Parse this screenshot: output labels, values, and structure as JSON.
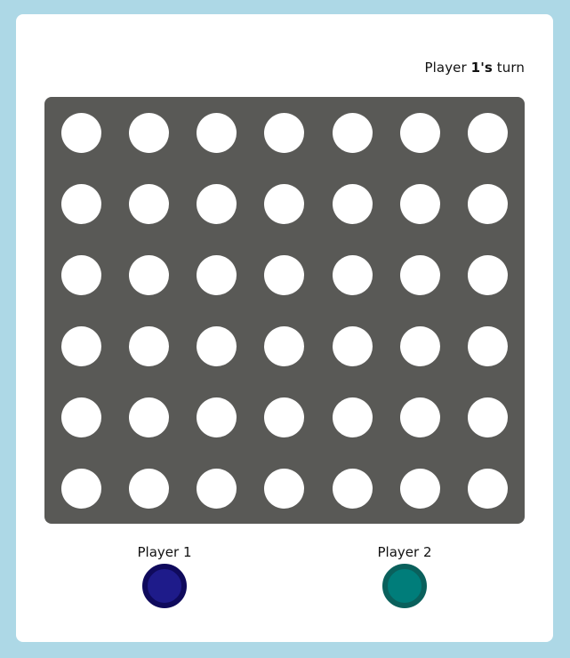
{
  "status": {
    "prefix": "Player",
    "player_number": "1's",
    "suffix": "turn"
  },
  "board": {
    "rows": 6,
    "columns": 7,
    "background_color": "#595956",
    "empty_slot_color": "#FFFFFF",
    "cells": [
      [
        "empty",
        "empty",
        "empty",
        "empty",
        "empty",
        "empty",
        "empty"
      ],
      [
        "empty",
        "empty",
        "empty",
        "empty",
        "empty",
        "empty",
        "empty"
      ],
      [
        "empty",
        "empty",
        "empty",
        "empty",
        "empty",
        "empty",
        "empty"
      ],
      [
        "empty",
        "empty",
        "empty",
        "empty",
        "empty",
        "empty",
        "empty"
      ],
      [
        "empty",
        "empty",
        "empty",
        "empty",
        "empty",
        "empty",
        "empty"
      ],
      [
        "empty",
        "empty",
        "empty",
        "empty",
        "empty",
        "empty",
        "empty"
      ]
    ]
  },
  "players": [
    {
      "label": "Player 1",
      "fill_color": "#1E1B8A",
      "ring_color": "#0F0A5C"
    },
    {
      "label": "Player 2",
      "fill_color": "#007D7A",
      "ring_color": "#0A605C"
    }
  ]
}
